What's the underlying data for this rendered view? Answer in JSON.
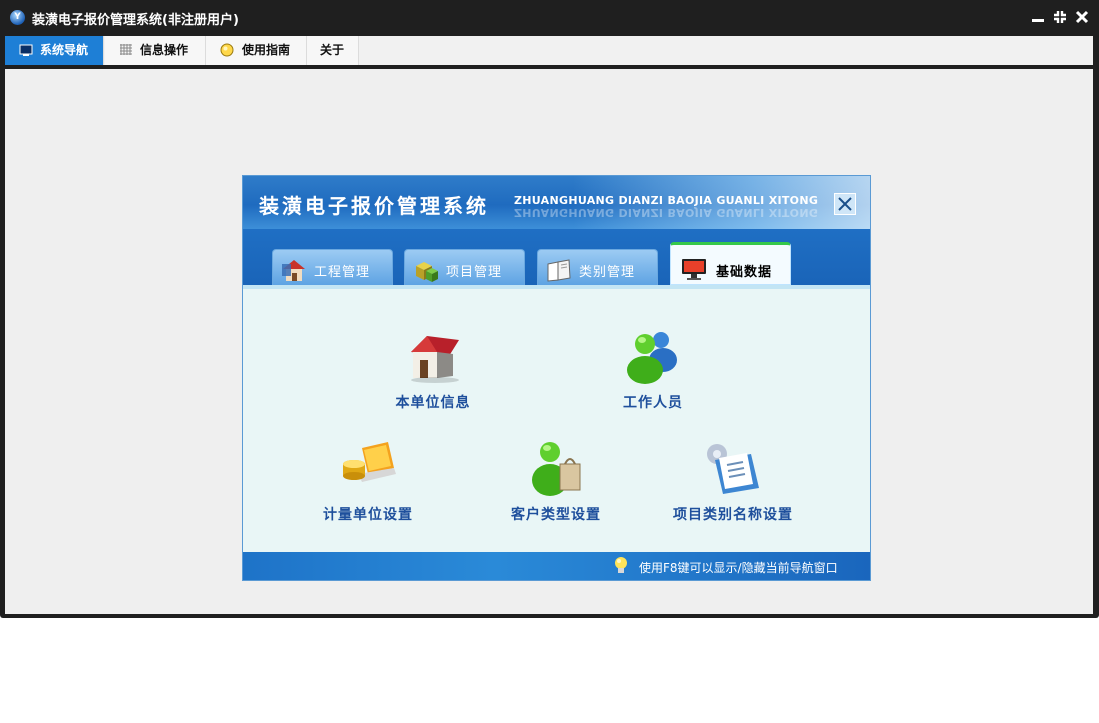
{
  "window": {
    "title": "装潢电子报价管理系统(非注册用户)",
    "logo_text": "Y"
  },
  "menu": {
    "tabs": [
      {
        "label": "系统导航",
        "icon": "monitor-icon",
        "active": true
      },
      {
        "label": "信息操作",
        "icon": "grid-icon",
        "active": false
      },
      {
        "label": "使用指南",
        "icon": "guide-bulb-icon",
        "active": false
      },
      {
        "label": "关于",
        "icon": "",
        "active": false
      }
    ]
  },
  "nav_panel": {
    "title": "装潢电子报价管理系统",
    "subtitle": "ZHUANGHUANG DIANZI BAOJIA GUANLI XITONG",
    "tabs": [
      {
        "label": "工程管理",
        "icon": "house-icon"
      },
      {
        "label": "项目管理",
        "icon": "cubes-icon"
      },
      {
        "label": "类别管理",
        "icon": "book-icon"
      },
      {
        "label": "基础数据",
        "icon": "monitor-icon",
        "active": true
      }
    ],
    "items": {
      "company_info": "本单位信息",
      "staff": "工作人员",
      "unit_setting": "计量单位设置",
      "customer_type": "客户类型设置",
      "category_name": "项目类别名称设置"
    },
    "status_text": "使用F8键可以显示/隐藏当前导航窗口"
  },
  "colors": {
    "accent": "#1e7fd6",
    "title_bar": "#1f1f1f",
    "panel_bg": "#e9f6f6",
    "item_text": "#1e4f9c",
    "active_tab_top": "#35c84a"
  }
}
